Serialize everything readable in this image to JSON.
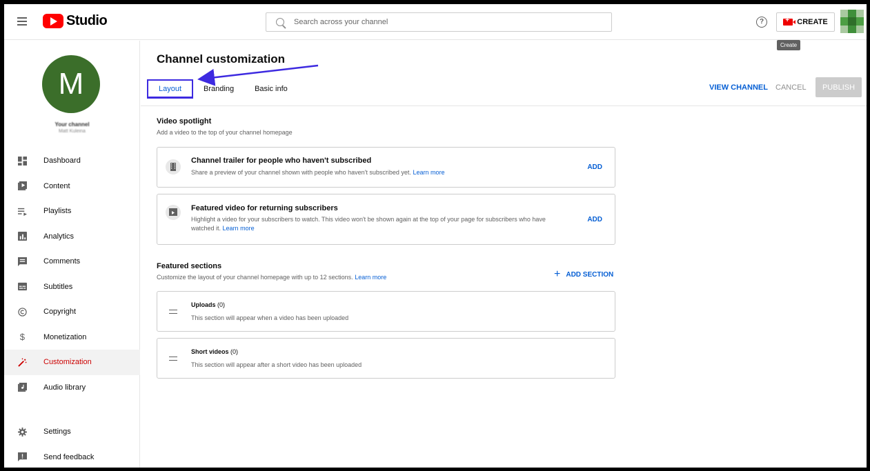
{
  "app": {
    "name": "Studio"
  },
  "header": {
    "search_placeholder": "Search across your channel",
    "help_icon": "help-circle-icon",
    "create_label": "CREATE",
    "create_tooltip": "Create"
  },
  "channel": {
    "avatar_letter": "M",
    "avatar_color": "#3b6e2a",
    "name": "Your channel",
    "owner": "Matt Kuleina"
  },
  "sidebar": {
    "items": [
      {
        "label": "Dashboard",
        "icon": "dashboard-icon",
        "active": false
      },
      {
        "label": "Content",
        "icon": "content-icon",
        "active": false
      },
      {
        "label": "Playlists",
        "icon": "playlists-icon",
        "active": false
      },
      {
        "label": "Analytics",
        "icon": "analytics-icon",
        "active": false
      },
      {
        "label": "Comments",
        "icon": "comments-icon",
        "active": false
      },
      {
        "label": "Subtitles",
        "icon": "subtitles-icon",
        "active": false
      },
      {
        "label": "Copyright",
        "icon": "copyright-icon",
        "active": false
      },
      {
        "label": "Monetization",
        "icon": "dollar-icon",
        "active": false
      },
      {
        "label": "Customization",
        "icon": "magic-wand-icon",
        "active": true
      },
      {
        "label": "Audio library",
        "icon": "audio-library-icon",
        "active": false
      }
    ],
    "bottom": [
      {
        "label": "Settings",
        "icon": "gear-icon"
      },
      {
        "label": "Send feedback",
        "icon": "feedback-icon"
      }
    ]
  },
  "main": {
    "title": "Channel customization",
    "tabs": [
      {
        "label": "Layout",
        "active": true
      },
      {
        "label": "Branding",
        "active": false
      },
      {
        "label": "Basic info",
        "active": false
      }
    ],
    "actions": {
      "view_channel": "VIEW CHANNEL",
      "cancel": "CANCEL",
      "publish": "PUBLISH"
    },
    "spotlight": {
      "title": "Video spotlight",
      "desc": "Add a video to the top of your channel homepage",
      "cards": [
        {
          "title": "Channel trailer for people who haven't subscribed",
          "desc": "Share a preview of your channel shown with people who haven't subscribed yet.",
          "desc_line2": "",
          "link": "Learn more",
          "action": "ADD",
          "icon": "film-icon"
        },
        {
          "title": "Featured video for returning subscribers",
          "desc": "Highlight a video for your subscribers to watch. This video won't be shown again at the top of your page for subscribers who have",
          "desc_line2": "watched it.",
          "link": "Learn more",
          "action": "ADD",
          "icon": "featured-video-icon"
        }
      ]
    },
    "featured": {
      "title": "Featured sections",
      "desc": "Customize the layout of your channel homepage with up to 12 sections.",
      "link": "Learn more",
      "add_label": "ADD SECTION",
      "sections": [
        {
          "name": "Uploads",
          "count": "(0)",
          "desc": "This section will appear when a video has been uploaded"
        },
        {
          "name": "Short videos",
          "count": "(0)",
          "desc": "This section will appear after a short video has been uploaded"
        }
      ]
    }
  },
  "colors": {
    "accent_blue": "#065fd4",
    "active_red": "#cc0000",
    "annotation_purple": "#3d2ae0",
    "youtube_red": "#ff0000"
  }
}
